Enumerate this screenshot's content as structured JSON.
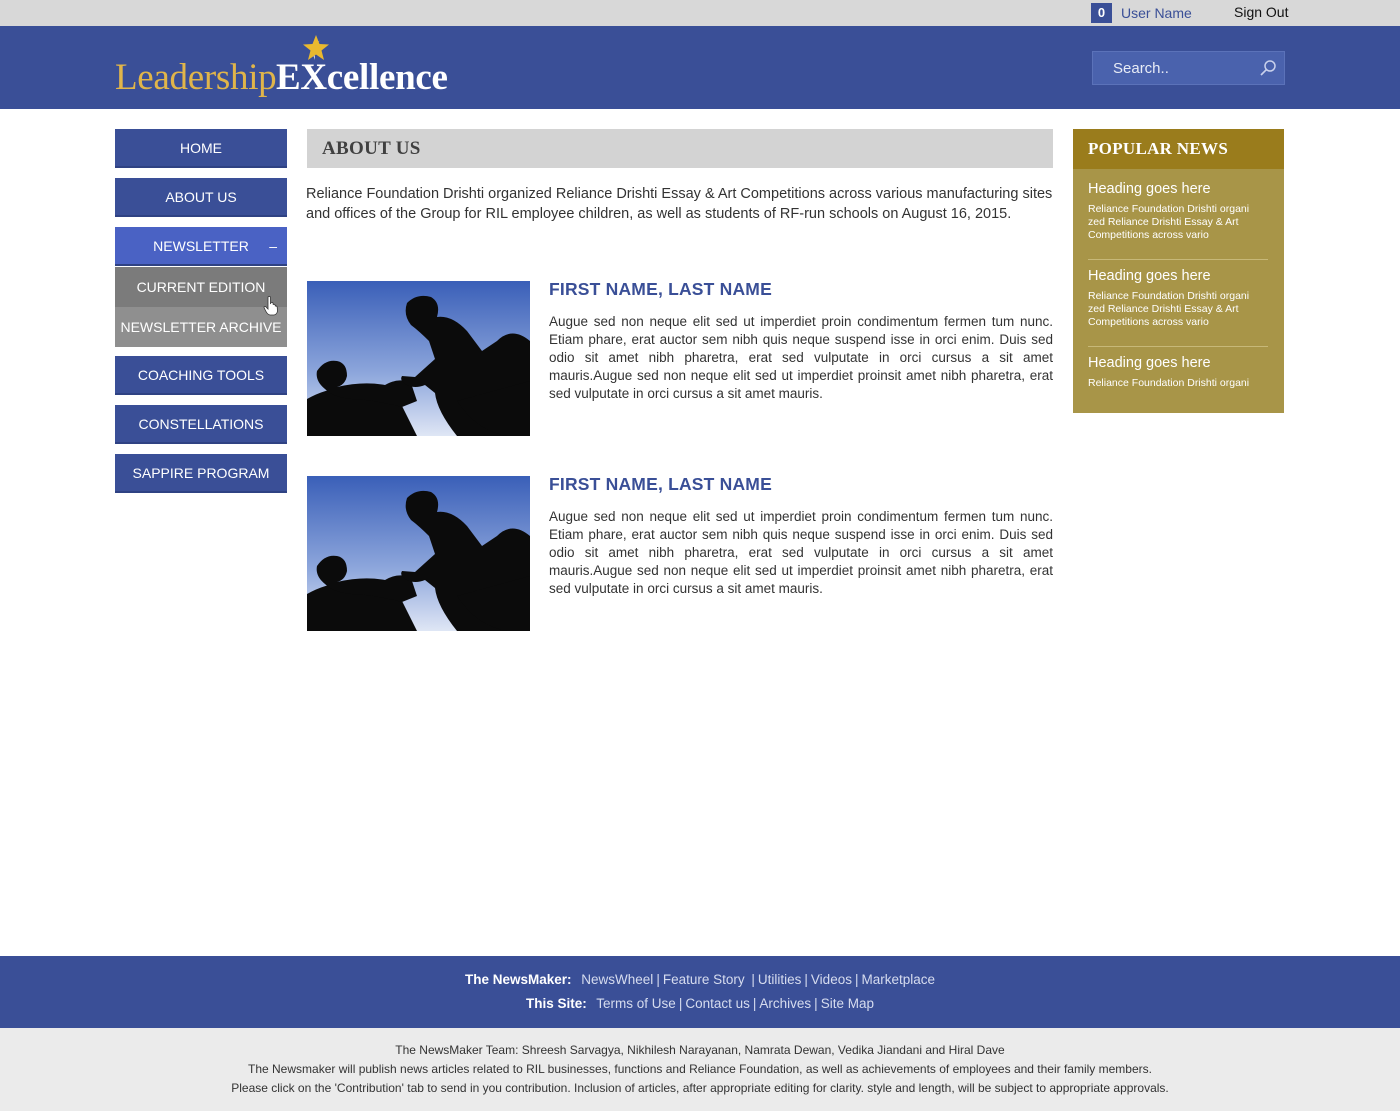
{
  "topbar": {
    "badge_count": "0",
    "user_name": "User Name",
    "sign_out": "Sign Out"
  },
  "header": {
    "logo_part1": "Leadership",
    "logo_part2": "EXcellence",
    "search_placeholder": "Search..",
    "brand_color": "#3a4f97",
    "accent_gold": "#e0b54a"
  },
  "nav": {
    "items": [
      {
        "label": "HOME"
      },
      {
        "label": "ABOUT US"
      },
      {
        "label": "NEWSLETTER",
        "toggle": "–"
      },
      {
        "label": "COACHING TOOLS"
      },
      {
        "label": "CONSTELLATIONS"
      },
      {
        "label": "SAPPIRE PROGRAM"
      }
    ],
    "sub_items": [
      {
        "label": "CURRENT EDITION"
      },
      {
        "label": "NEWSLETTER ARCHIVE"
      }
    ]
  },
  "main": {
    "title": "ABOUT US",
    "intro": "Reliance Foundation Drishti organized Reliance Drishti Essay & Art Competitions across various manufacturing sites and offices of the Group for RIL employee children, as well as students of RF-run schools on August 16, 2015.",
    "profiles": [
      {
        "name": "FIRST NAME, LAST NAME",
        "text": "Augue sed non neque elit sed ut imperdiet proin condimentum fermen tum nunc. Etiam phare, erat auctor sem nibh quis neque suspend isse in orci enim. Duis sed odio sit amet nibh pharetra, erat sed vulputate in orci cursus a sit amet mauris.Augue sed non neque elit sed ut imperdiet proinsit amet nibh pharetra, erat sed vulputate in orci cursus a sit amet mauris."
      },
      {
        "name": "FIRST NAME, LAST NAME",
        "text": "Augue sed non neque elit sed ut imperdiet proin condimentum fermen tum nunc. Etiam phare, erat auctor sem nibh quis neque suspend isse in orci enim. Duis sed odio sit amet nibh pharetra, erat sed vulputate in orci cursus a sit amet mauris.Augue sed non neque elit sed ut imperdiet proinsit amet nibh pharetra, erat sed vulputate in orci cursus a sit amet mauris."
      }
    ]
  },
  "popular": {
    "title": "POPULAR NEWS",
    "items": [
      {
        "heading": "Heading goes here",
        "text": "Reliance Foundation Drishti organi zed Reliance Drishti Essay & Art Competitions across vario"
      },
      {
        "heading": "Heading goes here",
        "text": "Reliance Foundation Drishti organi zed Reliance Drishti Essay & Art Competitions across vario"
      },
      {
        "heading": "Heading goes here",
        "text": "Reliance Foundation Drishti organi"
      }
    ]
  },
  "footer": {
    "newsmaker_label": "The NewsMaker:",
    "newsmaker_links": [
      "NewsWheel",
      "Feature Story",
      "Utilities",
      "Videos",
      "Marketplace"
    ],
    "site_label": "This Site:",
    "site_links": [
      "Terms of Use",
      "Contact us",
      "Archives",
      "Site Map"
    ],
    "team": "The NewsMaker Team: Shreesh Sarvagya, Nikhilesh Narayanan, Namrata Dewan, Vedika Jiandani and Hiral Dave",
    "publish_note": "The Newsmaker will publish news articles related to RIL businesses, functions and Reliance Foundation, as well as achievements of employees and their family members.",
    "contribution_note": "Please click on the 'Contribution' tab to send in you contribution. Inclusion of articles, after appropriate editing for clarity. style and length, will be subject to appropriate approvals."
  }
}
